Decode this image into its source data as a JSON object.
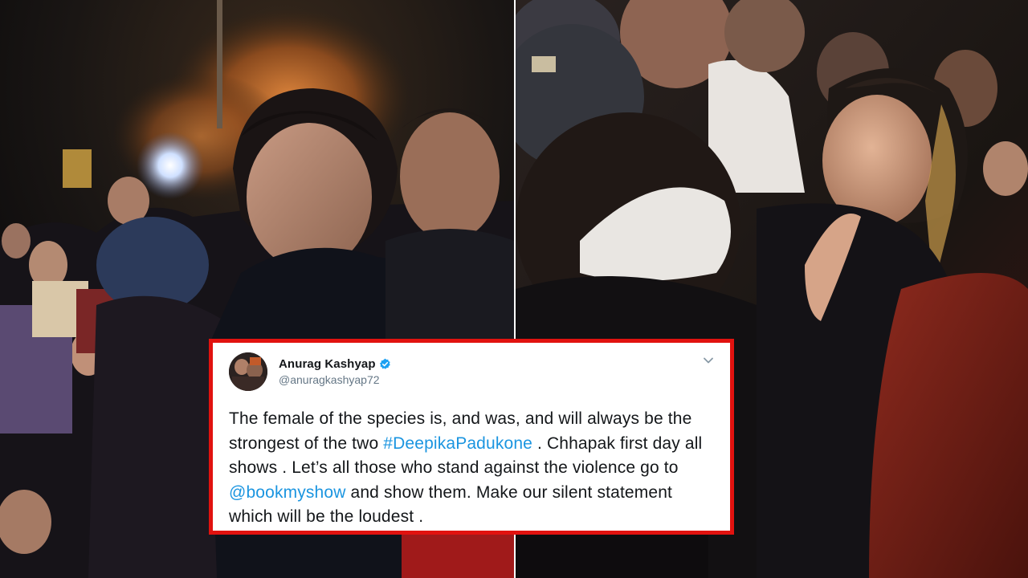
{
  "tweet": {
    "author_name": "Anurag Kashyap",
    "handle": "@anuragkashyap72",
    "text_part1": "The female of the species is, and was, and will always be the strongest of the two ",
    "hashtag": "#DeepikaPadukone",
    "text_part2": " . Chhapak first day all shows . Let’s all those who stand against the violence go to ",
    "mention": "@bookmyshow",
    "text_part3": " and show them. Make our silent statement which will be the loudest .",
    "icons": {
      "avatar": "author-avatar",
      "verified": "verified-badge-icon",
      "menu": "chevron-down-icon"
    }
  },
  "photos": {
    "left": "night-crowd-photo",
    "right": "greeting-photo"
  },
  "colors": {
    "frame_border": "#e1120f",
    "link": "#1b95e0",
    "text": "#14171a",
    "muted": "#657786"
  }
}
